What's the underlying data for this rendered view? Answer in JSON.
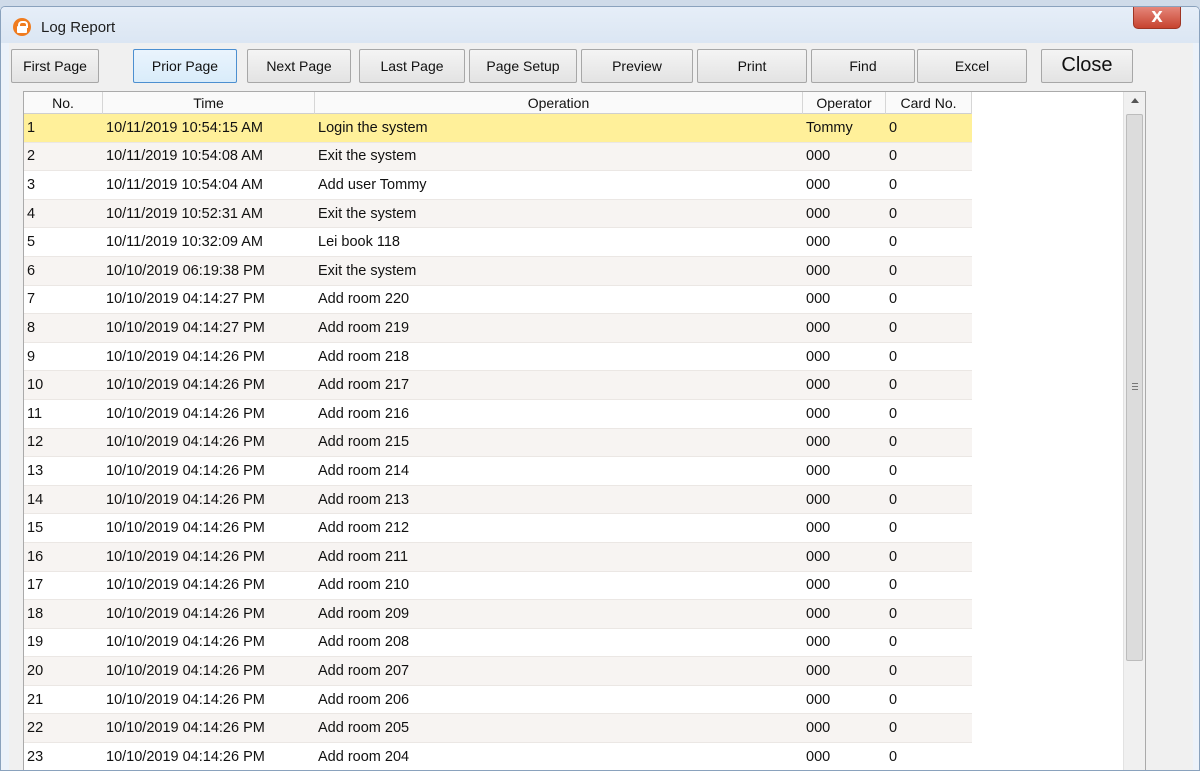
{
  "window": {
    "title": "Log Report",
    "close_glyph": "X",
    "icon": "lock-icon"
  },
  "toolbar": {
    "first_page": "First Page",
    "prior_page": "Prior Page",
    "next_page": "Next Page",
    "last_page": "Last Page",
    "page_setup": "Page Setup",
    "preview": "Preview",
    "print": "Print",
    "find": "Find",
    "excel": "Excel",
    "close": "Close"
  },
  "table": {
    "columns": [
      "No.",
      "Time",
      "Operation",
      "Operator",
      "Card No."
    ],
    "rows": [
      [
        "1",
        "10/11/2019 10:54:15 AM",
        "Login the system",
        "Tommy",
        "0"
      ],
      [
        "2",
        "10/11/2019 10:54:08 AM",
        "Exit the system",
        "000",
        "0"
      ],
      [
        "3",
        "10/11/2019 10:54:04 AM",
        "Add user Tommy",
        "000",
        "0"
      ],
      [
        "4",
        "10/11/2019 10:52:31 AM",
        "Exit the system",
        "000",
        "0"
      ],
      [
        "5",
        "10/11/2019 10:32:09 AM",
        "Lei book 118",
        "000",
        "0"
      ],
      [
        "6",
        "10/10/2019 06:19:38 PM",
        "Exit the system",
        "000",
        "0"
      ],
      [
        "7",
        "10/10/2019 04:14:27 PM",
        "Add room 220",
        "000",
        "0"
      ],
      [
        "8",
        "10/10/2019 04:14:27 PM",
        "Add room 219",
        "000",
        "0"
      ],
      [
        "9",
        "10/10/2019 04:14:26 PM",
        "Add room 218",
        "000",
        "0"
      ],
      [
        "10",
        "10/10/2019 04:14:26 PM",
        "Add room 217",
        "000",
        "0"
      ],
      [
        "11",
        "10/10/2019 04:14:26 PM",
        "Add room 216",
        "000",
        "0"
      ],
      [
        "12",
        "10/10/2019 04:14:26 PM",
        "Add room 215",
        "000",
        "0"
      ],
      [
        "13",
        "10/10/2019 04:14:26 PM",
        "Add room 214",
        "000",
        "0"
      ],
      [
        "14",
        "10/10/2019 04:14:26 PM",
        "Add room 213",
        "000",
        "0"
      ],
      [
        "15",
        "10/10/2019 04:14:26 PM",
        "Add room 212",
        "000",
        "0"
      ],
      [
        "16",
        "10/10/2019 04:14:26 PM",
        "Add room 211",
        "000",
        "0"
      ],
      [
        "17",
        "10/10/2019 04:14:26 PM",
        "Add room 210",
        "000",
        "0"
      ],
      [
        "18",
        "10/10/2019 04:14:26 PM",
        "Add room 209",
        "000",
        "0"
      ],
      [
        "19",
        "10/10/2019 04:14:26 PM",
        "Add room 208",
        "000",
        "0"
      ],
      [
        "20",
        "10/10/2019 04:14:26 PM",
        "Add room 207",
        "000",
        "0"
      ],
      [
        "21",
        "10/10/2019 04:14:26 PM",
        "Add room 206",
        "000",
        "0"
      ],
      [
        "22",
        "10/10/2019 04:14:26 PM",
        "Add room 205",
        "000",
        "0"
      ],
      [
        "23",
        "10/10/2019 04:14:26 PM",
        "Add room 204",
        "000",
        "0"
      ]
    ],
    "selected_row": 1
  },
  "colors": {
    "selected_row": "#fff09a",
    "title_bar": "#dbe6f3",
    "close_button": "#c7432f"
  }
}
